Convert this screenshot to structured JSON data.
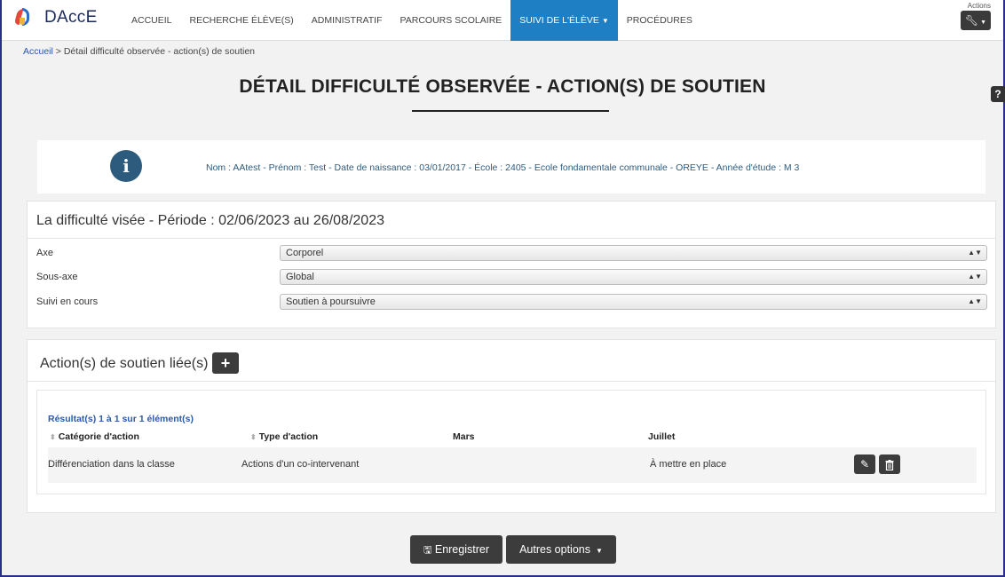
{
  "brand": {
    "name": "DAccE"
  },
  "nav": {
    "items": [
      {
        "label": "ACCUEIL"
      },
      {
        "label": "RECHERCHE ÉLÈVE(S)"
      },
      {
        "label": "ADMINISTRATIF"
      },
      {
        "label": "PARCOURS SCOLAIRE"
      },
      {
        "label": "SUIVI DE L'ÉLÈVE",
        "active": true
      },
      {
        "label": "PROCÉDURES"
      }
    ],
    "actions_label": "Actions"
  },
  "breadcrumb": {
    "home": "Accueil",
    "separator": ">",
    "current": "Détail difficulté observée - action(s) de soutien"
  },
  "page_title": "DÉTAIL DIFFICULTÉ OBSERVÉE - ACTION(S) DE SOUTIEN",
  "info": {
    "text": "Nom : AAtest - Prénom : Test - Date de naissance : 03/01/2017 - École : 2405 - Ecole fondamentale communale - OREYE - Année d'étude : M 3"
  },
  "difficulty": {
    "title": "La difficulté visée - Période : 02/06/2023 au 26/08/2023",
    "fields": [
      {
        "label": "Axe",
        "value": "Corporel"
      },
      {
        "label": "Sous-axe",
        "value": "Global"
      },
      {
        "label": "Suivi en cours",
        "value": "Soutien à poursuivre"
      }
    ]
  },
  "support_actions": {
    "title": "Action(s) de soutien liée(s)",
    "add_label": "+",
    "results": "Résultat(s) 1 à 1 sur 1 élément(s)",
    "columns": [
      "Catégorie d'action",
      "Type d'action",
      "Mars",
      "Juillet"
    ],
    "rows": [
      {
        "category": "Différenciation dans la classe",
        "type": "Actions d'un co-intervenant",
        "mars": "",
        "juillet": "À mettre en place"
      }
    ]
  },
  "buttons": {
    "save": "Enregistrer",
    "more": "Autres options"
  },
  "colors": {
    "nav_active": "#1f7fc4",
    "info": "#2d5b7e",
    "link": "#2b5aa8",
    "dark_button": "#3c3c3c"
  }
}
